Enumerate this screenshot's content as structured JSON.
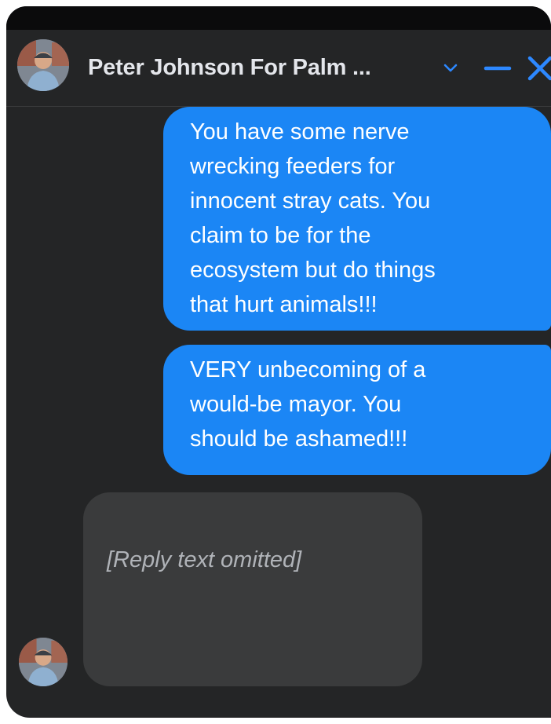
{
  "header": {
    "contact_name": "Peter Johnson For Palm ...",
    "icons": {
      "avatar": "profile-photo",
      "chevron": "chevron-down-icon",
      "minimize": "minimize-icon",
      "close": "close-icon"
    }
  },
  "messages": [
    {
      "direction": "outgoing",
      "text": "You have some nerve\nwrecking feeders for\ninnocent stray cats. You\nclaim to be for the\necosystem but do things\nthat hurt animals!!!"
    },
    {
      "direction": "outgoing",
      "text": "VERY unbecoming of a\nwould-be mayor. You\nshould be ashamed!!!"
    },
    {
      "direction": "incoming",
      "text": "[Reply text omitted]"
    }
  ],
  "colors": {
    "window_background": "#242526",
    "outgoing_bubble": "#1b86f5",
    "incoming_bubble": "#3a3b3c",
    "accent": "#2d88ff",
    "header_text": "#e4e6eb"
  }
}
